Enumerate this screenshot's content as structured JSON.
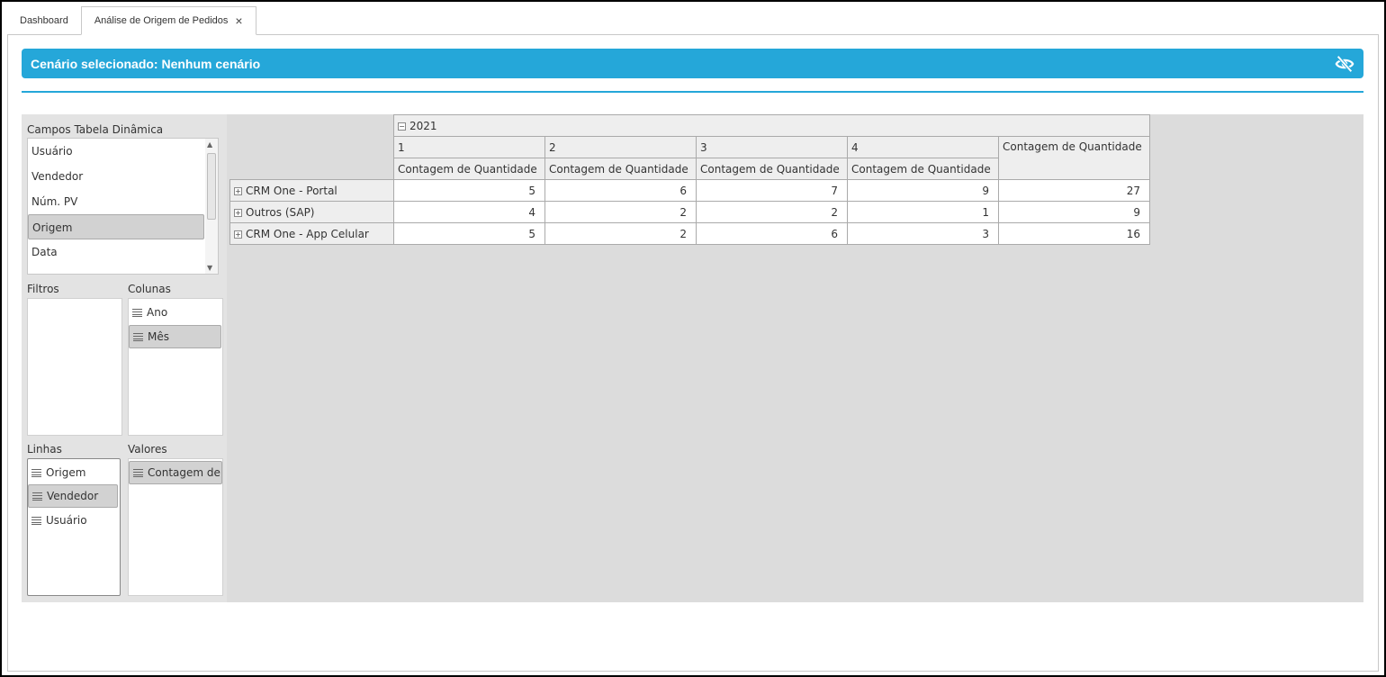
{
  "tabs": [
    {
      "label": "Dashboard",
      "active": false
    },
    {
      "label": "Análise de Origem de Pedidos",
      "active": true,
      "close_icon": "×"
    }
  ],
  "scenario": {
    "title": "Cenário selecionado: Nenhum cenário",
    "icon": "eye-off-icon",
    "color": "#25a7d9"
  },
  "fields_panel": {
    "title": "Campos Tabela Dinâmica",
    "items": [
      "Usuário",
      "Vendedor",
      "Núm. PV",
      "Origem",
      "Data"
    ],
    "selected": "Origem"
  },
  "filters": {
    "label": "Filtros",
    "items": []
  },
  "columns": {
    "label": "Colunas",
    "items": [
      "Ano",
      "Mês"
    ],
    "selected": "Mês"
  },
  "rows": {
    "label": "Linhas",
    "items": [
      "Origem",
      "Vendedor",
      "Usuário"
    ],
    "selected": "Vendedor"
  },
  "values": {
    "label": "Valores",
    "items": [
      "Contagem de Quantidade"
    ]
  },
  "pivot": {
    "year": "2021",
    "year_toggle": "−",
    "months": [
      "1",
      "2",
      "3",
      "4"
    ],
    "measure": "Contagem de Quantidade",
    "grand_total_label": "Contagem de Quantidade",
    "row_toggle": "+",
    "rows": [
      {
        "label": "CRM One - Portal",
        "values": [
          "5",
          "6",
          "7",
          "9"
        ],
        "total": "27"
      },
      {
        "label": "Outros (SAP)",
        "values": [
          "4",
          "2",
          "2",
          "1"
        ],
        "total": "9"
      },
      {
        "label": "CRM One - App Celular",
        "values": [
          "5",
          "2",
          "6",
          "3"
        ],
        "total": "16"
      }
    ]
  }
}
